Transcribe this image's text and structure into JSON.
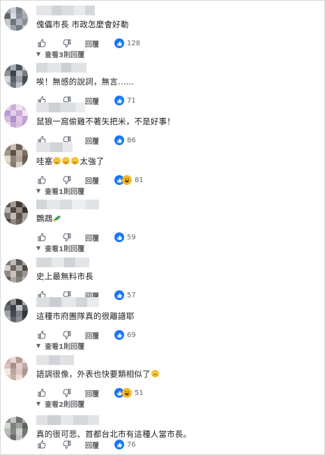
{
  "actions": {
    "reply_label": "回覆"
  },
  "comments": [
    {
      "text": "傀儡市長 市政怎麼會好勒",
      "count": "128",
      "more": "查看3則回覆",
      "haha": false
    },
    {
      "text": "唉！無感的說詞，無言......",
      "count": "71",
      "more": "",
      "haha": false
    },
    {
      "text": "鼠狼一窩偷雞不著矢把米，不是好事！",
      "count": "86",
      "more": "",
      "haha": false
    },
    {
      "text": "哇塞",
      "text_suffix": "太強了",
      "emojis": 3,
      "count": "81",
      "more": "查看1則回覆",
      "haha": true
    },
    {
      "text": "鸚鵡",
      "text_suffix": "",
      "bird": true,
      "count": "59",
      "more": "查看1則回覆",
      "haha": false
    },
    {
      "text": "史上最無料市長",
      "count": "57",
      "more": "",
      "haha": false
    },
    {
      "text": "這種市府團隊真的很離譜耶",
      "count": "69",
      "more": "查看1則回覆",
      "haha": false
    },
    {
      "text": "語調很像，外表也快要類相似了",
      "sad_emoji": true,
      "count": "51",
      "more": "查看2則回覆",
      "haha": true
    },
    {
      "text": "真的很可悲、首都台北市有這種人當市長。",
      "count": "76",
      "more": "",
      "haha": false
    }
  ],
  "colors": {
    "like_blue": "#1877f2",
    "haha_yellow": "#f7b928",
    "meta_gray": "#65676b"
  },
  "icons": [
    "thumbs-up-icon",
    "thumbs-down-icon",
    "like-reaction-icon",
    "haha-reaction-icon",
    "chevron-down-icon"
  ]
}
